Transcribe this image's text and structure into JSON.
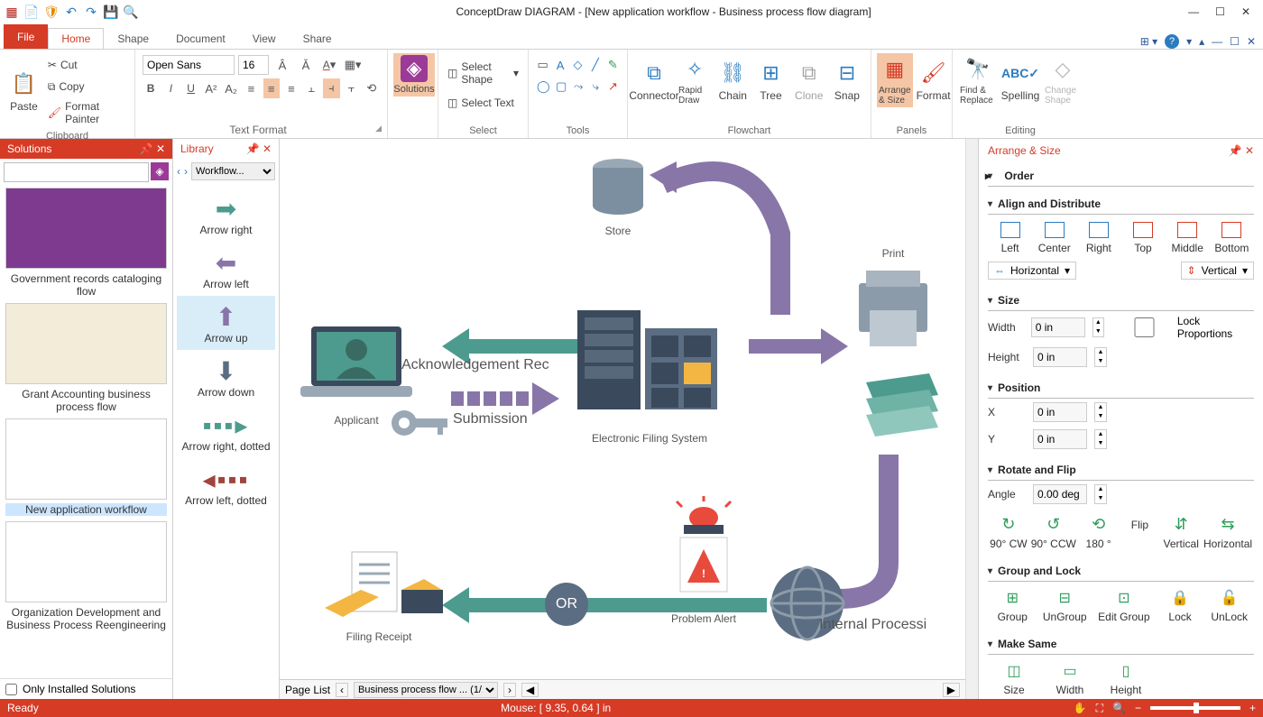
{
  "title": "ConceptDraw DIAGRAM - [New application workflow - Business process flow diagram]",
  "tabs": {
    "file": "File",
    "home": "Home",
    "shape": "Shape",
    "document": "Document",
    "view": "View",
    "share": "Share"
  },
  "ribbon": {
    "paste": "Paste",
    "cut": "Cut",
    "copy": "Copy",
    "fmtpainter": "Format Painter",
    "clipboard": "Clipboard",
    "font": "Open Sans",
    "size": "16",
    "textformat": "Text Format",
    "solutions": "Solutions",
    "selectshape": "Select Shape",
    "selecttext": "Select Text",
    "select": "Select",
    "tools": "Tools",
    "connector": "Connector",
    "rapiddraw": "Rapid Draw",
    "chain": "Chain",
    "tree": "Tree",
    "clone": "Clone",
    "snap": "Snap",
    "flowchart": "Flowchart",
    "arrangesize": "Arrange & Size",
    "format": "Format",
    "panels": "Panels",
    "findreplace": "Find & Replace",
    "spelling": "Spelling",
    "changeshape": "Change Shape",
    "editing": "Editing"
  },
  "solpanel": {
    "title": "Solutions",
    "items": [
      "Government records cataloging flow",
      "Grant Accounting business process flow",
      "New application workflow",
      "Organization Development and Business Process Reengineering"
    ],
    "only": "Only Installed Solutions"
  },
  "libpanel": {
    "title": "Library",
    "dropdown": "Workflow...",
    "shapes": [
      "Arrow right",
      "Arrow left",
      "Arrow up",
      "Arrow down",
      "Arrow right, dotted",
      "Arrow left, dotted"
    ]
  },
  "canvas": {
    "store": "Store",
    "print": "Print",
    "applicant": "Applicant",
    "ack": "Acknowledgement Rec",
    "submission": "Submission",
    "efs": "Electronic Filing System",
    "or": "OR",
    "filing": "Filing Receipt",
    "alert": "Problem Alert",
    "internal": "Internal Processi"
  },
  "pagebar": {
    "label": "Page List",
    "page": "Business process flow ... (1/1)"
  },
  "arrange": {
    "title": "Arrange & Size",
    "order": "Order",
    "align": "Align and Distribute",
    "left": "Left",
    "center": "Center",
    "right": "Right",
    "top": "Top",
    "middle": "Middle",
    "bottom": "Bottom",
    "horizontal": "Horizontal",
    "vertical": "Vertical",
    "size": "Size",
    "width": "Width",
    "height": "Height",
    "lockprop": "Lock Proportions",
    "zeroin": "0 in",
    "position": "Position",
    "x": "X",
    "y": "Y",
    "rotate": "Rotate and Flip",
    "angle": "Angle",
    "angleval": "0.00 deg",
    "cw": "90° CW",
    "ccw": "90° CCW",
    "r180": "180 °",
    "flip": "Flip",
    "vflip": "Vertical",
    "hflip": "Horizontal",
    "grouplock": "Group and Lock",
    "group": "Group",
    "ungroup": "UnGroup",
    "editgroup": "Edit Group",
    "lock": "Lock",
    "unlock": "UnLock",
    "makesame": "Make Same",
    "mssize": "Size",
    "mswidth": "Width",
    "msheight": "Height"
  },
  "status": {
    "ready": "Ready",
    "mouse": "Mouse: [ 9.35, 0.64 ] in"
  }
}
